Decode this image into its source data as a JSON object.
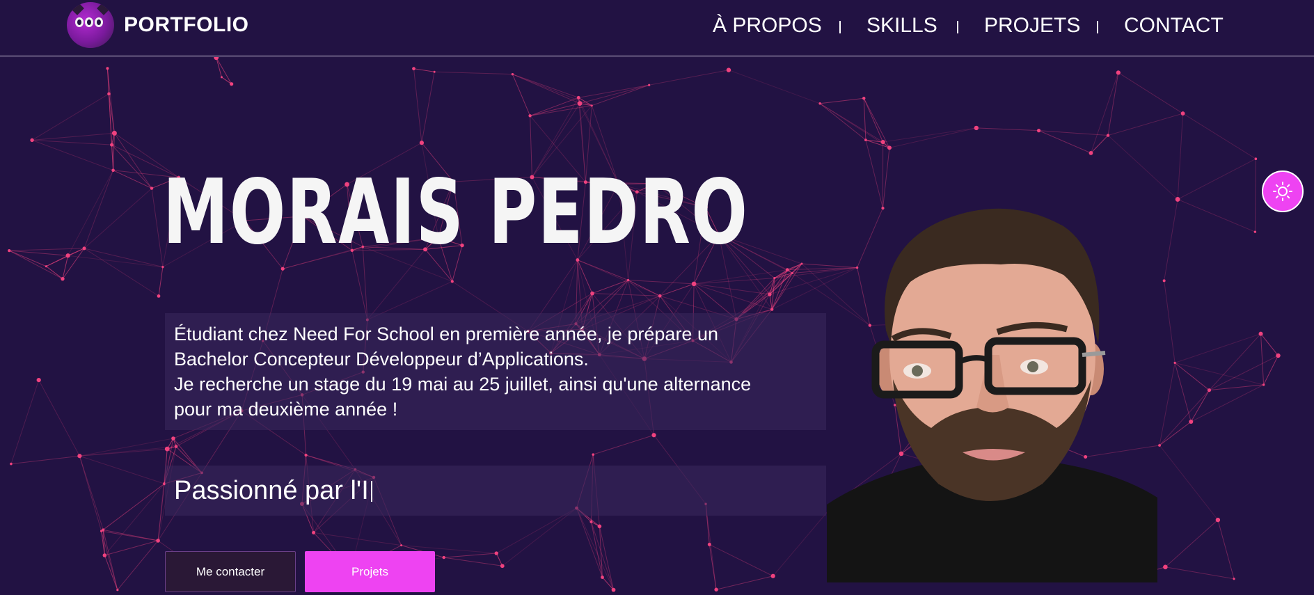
{
  "header": {
    "brand": "PORTFOLIO",
    "nav": [
      {
        "label": "À PROPOS"
      },
      {
        "label": "SKILLS"
      },
      {
        "label": "PROJETS"
      },
      {
        "label": "CONTACT"
      }
    ]
  },
  "hero": {
    "name": "MORAIS PEDRO",
    "intro_line1": "Étudiant chez Need For School en première année, je prépare un",
    "intro_line2": "Bachelor Concepteur Développeur d’Applications.",
    "intro_line3": "Je recherche un stage du 19 mai au 25 juillet, ainsi qu'une alternance",
    "intro_line4": "pour ma deuxième année !",
    "typing_text": "Passionné par l'I"
  },
  "buttons": {
    "contact": "Me contacter",
    "projects": "Projets"
  },
  "colors": {
    "background": "#221243",
    "accent": "#ee43f2",
    "particle": "#f0427f"
  },
  "icons": {
    "theme_toggle": "sun-icon",
    "logo": "cat-logo-icon"
  }
}
